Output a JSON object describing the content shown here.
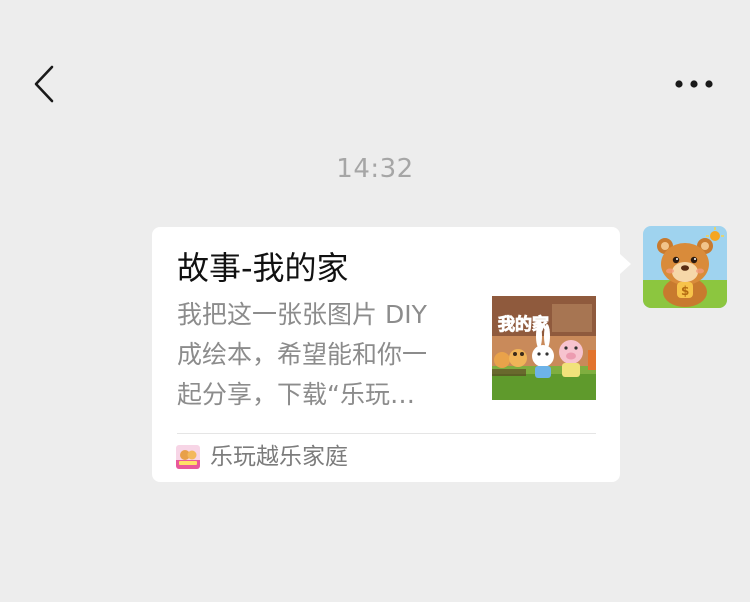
{
  "header": {
    "back_icon": "chevron-left-icon",
    "more_icon": "more-dots-icon"
  },
  "chat": {
    "timestamp": "14:32",
    "message": {
      "title": "故事-我的家",
      "description_lines": [
        "我把这一张张图片 DIY",
        "成绘本，希望能和你一",
        "起分享，下载“乐玩…"
      ],
      "thumbnail_caption": "我的家",
      "source_name": "乐玩越乐家庭",
      "source_icon": "app-logo-icon",
      "avatar": "bear-avatar-icon"
    }
  },
  "colors": {
    "background": "#ededed",
    "bubble": "#ffffff",
    "title": "#111111",
    "description": "#8c8c8c",
    "timestamp": "#a6a6a6"
  }
}
